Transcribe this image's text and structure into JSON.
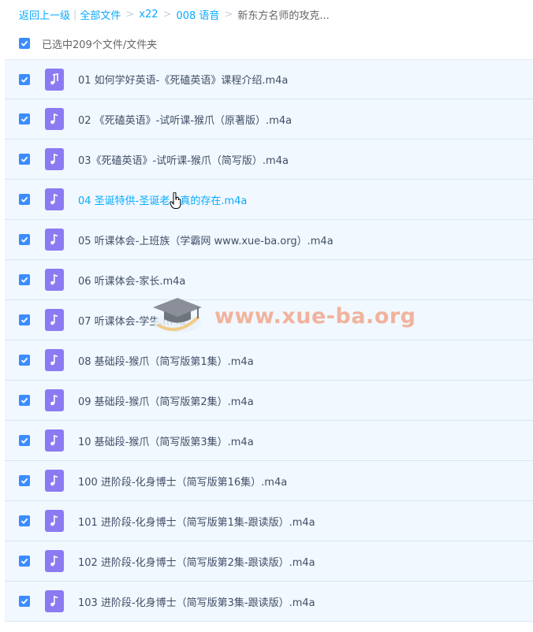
{
  "breadcrumb": {
    "back": "返回上一级",
    "all_files": "全部文件",
    "items": [
      "x22",
      "008 语音"
    ],
    "current": "新东方名师的攻克..."
  },
  "selection": {
    "summary": "已选中209个文件/文件夹"
  },
  "files": [
    {
      "name": "01 如何学好英语-《死磕英语》课程介绍.m4a"
    },
    {
      "name": "02 《死磕英语》-试听课-猴爪（原著版）.m4a"
    },
    {
      "name": "03《死磕英语》-试听课-猴爪（简写版）.m4a"
    },
    {
      "name": "04 圣诞特供-圣诞老人真的存在.m4a"
    },
    {
      "name": "05 听课体会-上班族（学霸网 www.xue-ba.org）.m4a"
    },
    {
      "name": "06 听课体会-家长.m4a"
    },
    {
      "name": "07 听课体会-学生.m4a"
    },
    {
      "name": "08 基础段-猴爪（简写版第1集）.m4a"
    },
    {
      "name": "09 基础段-猴爪（简写版第2集）.m4a"
    },
    {
      "name": "10 基础段-猴爪（简写版第3集）.m4a"
    },
    {
      "name": "100 进阶段-化身博士（简写版第16集）.m4a"
    },
    {
      "name": "101 进阶段-化身博士（简写版第1集-跟读版）.m4a"
    },
    {
      "name": "102 进阶段-化身博士（简写版第2集-跟读版）.m4a"
    },
    {
      "name": "103 进阶段-化身博士（简写版第3集-跟读版）.m4a"
    }
  ],
  "watermark": {
    "text": "www.xue-ba.org"
  },
  "colors": {
    "accent": "#09aaff",
    "checkbox": "#3b8cff",
    "audio_icon": "#8b7bf2",
    "row_bg": "#f1f8ff"
  }
}
